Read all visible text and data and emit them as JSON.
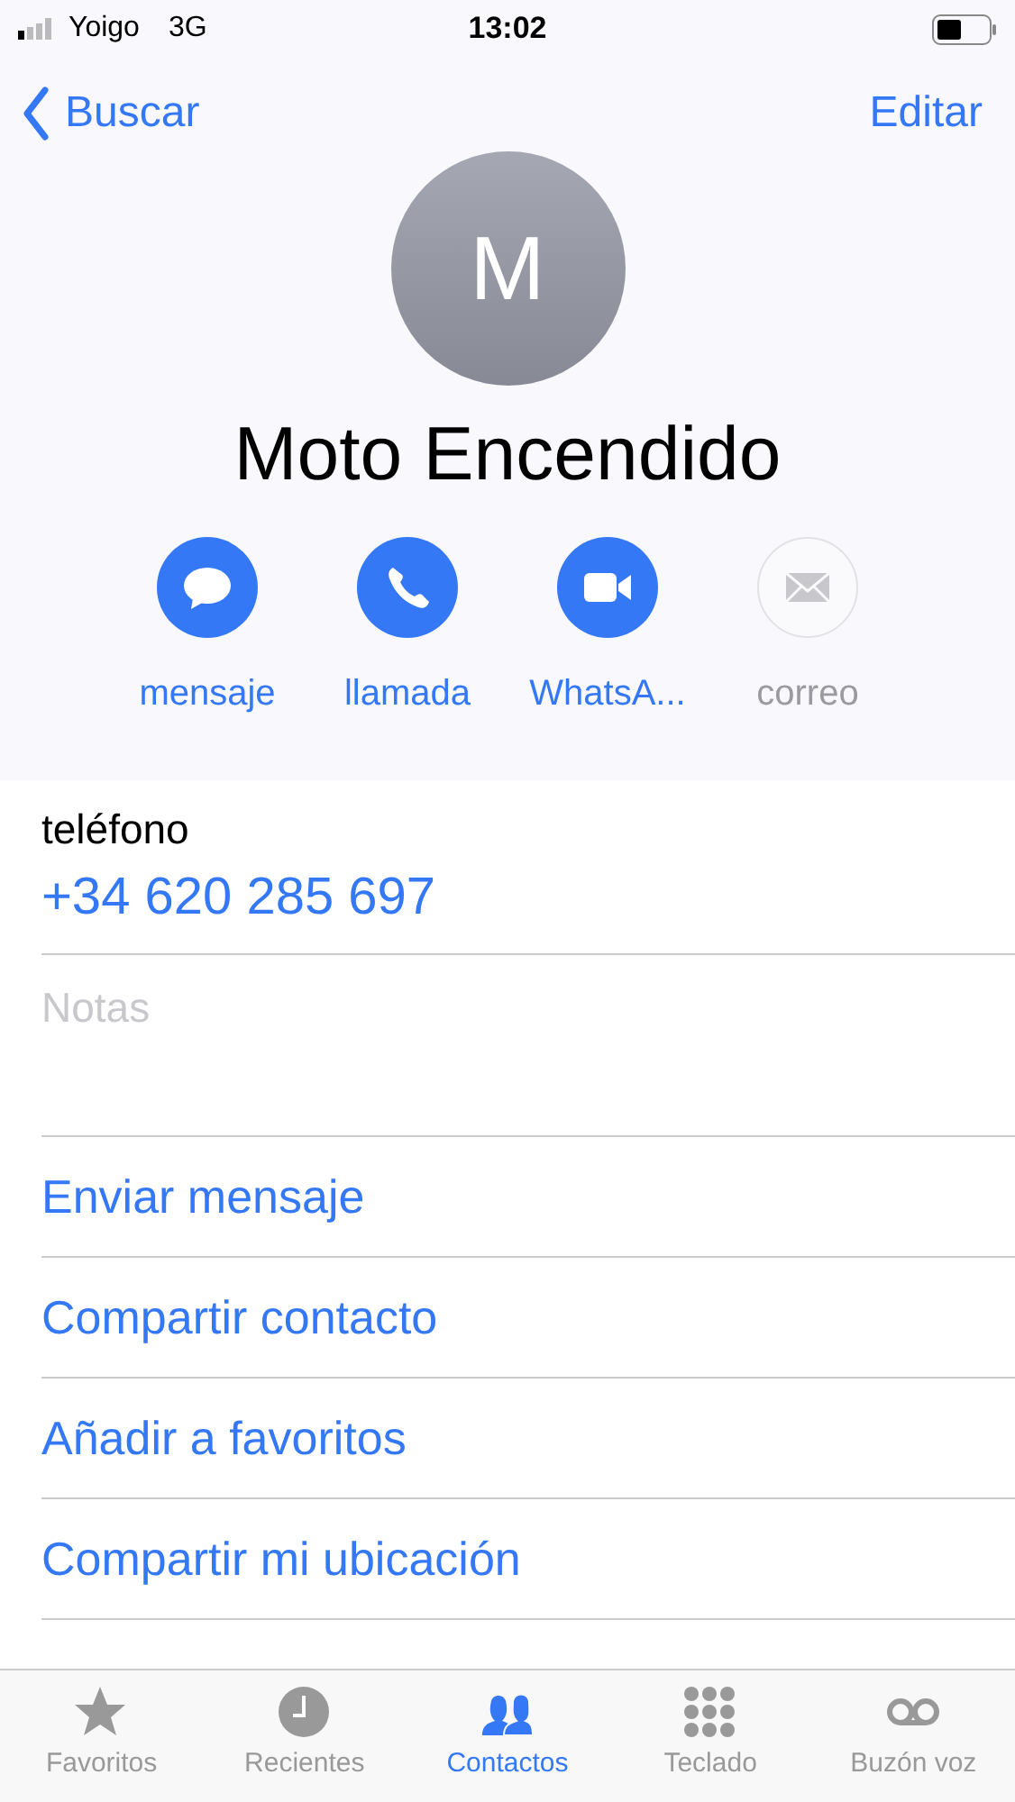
{
  "status_bar": {
    "carrier": "Yoigo",
    "network": "3G",
    "time": "13:02"
  },
  "nav": {
    "back": "Buscar",
    "edit": "Editar"
  },
  "contact": {
    "initial": "M",
    "name": "Moto Encendido"
  },
  "actions": [
    {
      "kind": "message",
      "label": "mensaje",
      "disabled": false
    },
    {
      "kind": "call",
      "label": "llamada",
      "disabled": false
    },
    {
      "kind": "video",
      "label": "WhatsA...",
      "disabled": false
    },
    {
      "kind": "mail",
      "label": "correo",
      "disabled": true
    }
  ],
  "phone": {
    "label": "teléfono",
    "value": "+34 620 285 697"
  },
  "notes": {
    "placeholder": "Notas"
  },
  "links": [
    "Enviar mensaje",
    "Compartir contacto",
    "Añadir a favoritos",
    "Compartir mi ubicación"
  ],
  "tabs": [
    {
      "kind": "star",
      "label": "Favoritos",
      "selected": false
    },
    {
      "kind": "clock",
      "label": "Recientes",
      "selected": false
    },
    {
      "kind": "people",
      "label": "Contactos",
      "selected": true
    },
    {
      "kind": "keypad",
      "label": "Teclado",
      "selected": false
    },
    {
      "kind": "voicemail",
      "label": "Buzón voz",
      "selected": false
    }
  ]
}
